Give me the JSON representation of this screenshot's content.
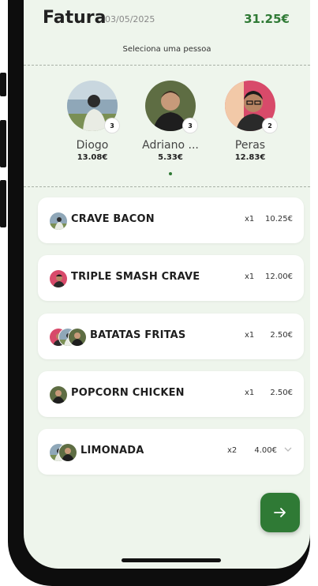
{
  "header": {
    "title": "Fatura",
    "date": "03/05/2025",
    "total": "31.25€",
    "subtitle": "Seleciona uma pessoa"
  },
  "people": [
    {
      "name": "Diogo",
      "amount": "13.08€",
      "badge": "3",
      "icon": "avatar-diogo"
    },
    {
      "name": "Adriano ...",
      "amount": "5.33€",
      "badge": "3",
      "icon": "avatar-adriano"
    },
    {
      "name": "Peras",
      "amount": "12.83€",
      "badge": "2",
      "icon": "avatar-peras"
    }
  ],
  "items": [
    {
      "name": "CRAVE BACON",
      "qty": "x1",
      "price": "10.25€"
    },
    {
      "name": "TRIPLE SMASH CRAVE",
      "qty": "x1",
      "price": "12.00€"
    },
    {
      "name": "BATATAS FRITAS",
      "qty": "x1",
      "price": "2.50€"
    },
    {
      "name": "POPCORN CHICKEN",
      "qty": "x1",
      "price": "2.50€"
    },
    {
      "name": "LIMONADA",
      "qty": "x2",
      "price": "4.00€"
    }
  ],
  "icons": {
    "next": "arrow-right-icon",
    "expand": "chevron-down-icon"
  },
  "colors": {
    "accent": "#2f7a35",
    "background": "#eef5ec",
    "card": "#ffffff"
  }
}
